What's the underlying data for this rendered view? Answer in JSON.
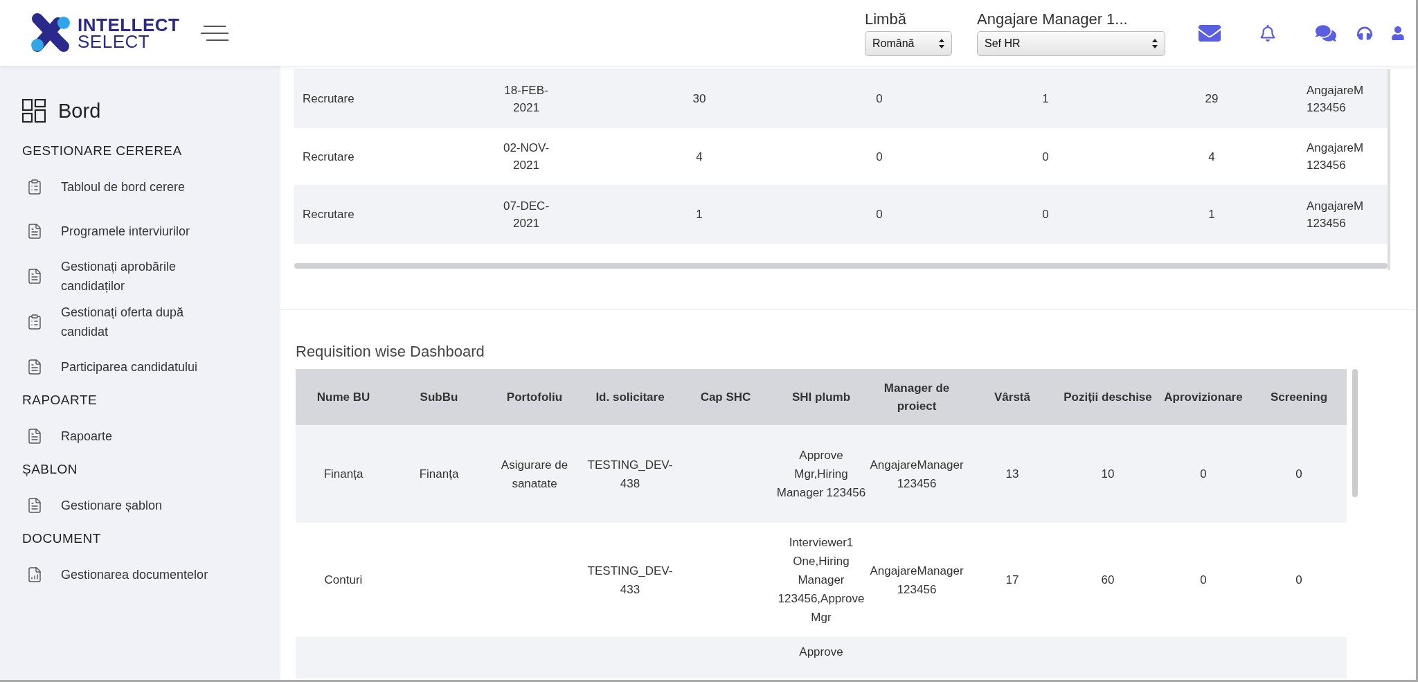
{
  "header": {
    "logo": {
      "line_1": "INTELLECT",
      "line_2": "SELECT"
    },
    "language": {
      "label": "Limbă",
      "value": "Română"
    },
    "role": {
      "label": "Angajare Manager 1...",
      "value": "Sef HR"
    }
  },
  "sidebar": {
    "title": "Bord",
    "sections": [
      {
        "heading": "GESTIONARE CEREREA",
        "items": [
          {
            "label": "Tabloul de bord cerere",
            "kind": "clipboard"
          },
          {
            "label": "Programele interviurilor",
            "kind": "document"
          },
          {
            "label": "Gestionați aprobările candidaților",
            "kind": "document"
          },
          {
            "label": "Gestionați oferta după candidat",
            "kind": "clipboard"
          },
          {
            "label": "Participarea candidatului",
            "kind": "document"
          }
        ]
      },
      {
        "heading": "RAPOARTE",
        "items": [
          {
            "label": "Rapoarte",
            "kind": "document"
          }
        ]
      },
      {
        "heading": "ȘABLON",
        "items": [
          {
            "label": "Gestionare șablon",
            "kind": "document"
          }
        ]
      },
      {
        "heading": "DOCUMENT",
        "items": [
          {
            "label": "Gestionarea documentelor",
            "kind": "chart"
          }
        ]
      }
    ]
  },
  "summary_table": {
    "rows": [
      {
        "cells": [
          "Recrutare",
          "18-FEB-\n2021",
          "30",
          "0",
          "1",
          "29",
          "AngajareM\n123456"
        ]
      },
      {
        "cells": [
          "Recrutare",
          "02-NOV-\n2021",
          "4",
          "0",
          "0",
          "4",
          "AngajareM\n123456"
        ]
      },
      {
        "cells": [
          "Recrutare",
          "07-DEC-\n2021",
          "1",
          "0",
          "0",
          "1",
          "AngajareM\n123456"
        ]
      }
    ]
  },
  "requisition_dashboard": {
    "title": "Requisition wise Dashboard",
    "columns": [
      "Nume BU",
      "SubBu",
      "Portofoliu",
      "Id. solicitare",
      "Cap SHC",
      "SHI plumb",
      "Manager de proiect",
      "Vârstă",
      "Poziții deschise",
      "Aprovizionare",
      "Screening"
    ],
    "rows": [
      {
        "cells": [
          "Finanța",
          "Finanța",
          "Asigurare de sanatate",
          "TESTING_DEV-438",
          null,
          "Approve Mgr,Hiring Manager 123456",
          "AngajareManager 123456",
          "13",
          "10",
          "0",
          "0"
        ]
      },
      {
        "cells": [
          "Conturi",
          null,
          null,
          "TESTING_DEV-433",
          null,
          "Interviewer1 One,Hiring Manager 123456,Approve Mgr",
          "AngajareManager 123456",
          "17",
          "60",
          "0",
          "0"
        ]
      },
      {
        "cells": [
          null,
          null,
          null,
          null,
          null,
          "Approve",
          null,
          null,
          null,
          null,
          null
        ]
      }
    ]
  }
}
